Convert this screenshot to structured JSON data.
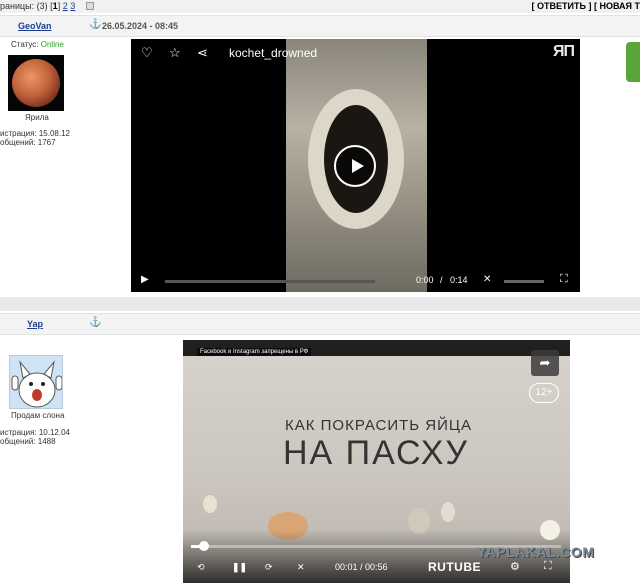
{
  "topbar": {
    "pages_prefix": "раницы: (3)",
    "pages": [
      "1",
      "2",
      "3"
    ],
    "current_page": "1",
    "actions": "[ ОТВЕТИТЬ ] [ НОВАЯ Т"
  },
  "posts": [
    {
      "username": "GeoVan",
      "date": "26.05.2024 - 08:45",
      "status_label": "Статус:",
      "status_value": "Online",
      "avatar_caption": "Ярила",
      "registration": "истрация: 15.08.12",
      "messages": "общений: 1767",
      "video": {
        "title": "kochet_drowned",
        "logo": "ЯП",
        "time_current": "0:00",
        "time_sep": "/",
        "time_total": "0:14"
      }
    },
    {
      "username": "Yap",
      "avatar_caption": "Продам слона",
      "registration": "истрация: 10.12.04",
      "messages": "общений: 1488",
      "video": {
        "news_label": "Facebook и Instagram запрещены в РФ",
        "age_rating": "12+",
        "headline_line1": "КАК ПОКРАСИТЬ ЯЙЦА",
        "headline_line2": "НА ПАСХУ",
        "progress_percent": 3,
        "time_current": "00:01",
        "time_total": "00:56",
        "time_display": "00:01 / 00:56",
        "brand": "RUTUBE"
      }
    }
  ],
  "watermark": "YAPLAKAL.COM",
  "icons": [
    "anchor-icon",
    "heart-icon",
    "star-icon",
    "share-icon",
    "play-icon",
    "mute-icon",
    "fullscreen-icon",
    "rewind-10-icon",
    "pause-icon",
    "forward-10-icon",
    "settings-icon"
  ]
}
